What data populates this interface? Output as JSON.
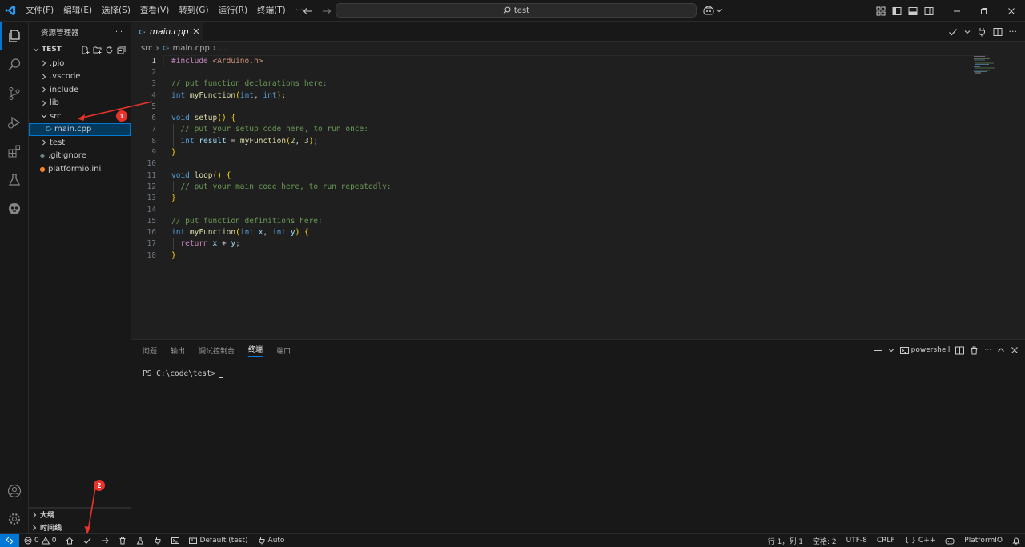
{
  "titlebar": {
    "menu": [
      "文件(F)",
      "编辑(E)",
      "选择(S)",
      "查看(V)",
      "转到(G)",
      "运行(R)",
      "终端(T)",
      "···"
    ],
    "search_text": "test"
  },
  "sidebar": {
    "header": "资源管理器",
    "more": "···",
    "folder": "TEST",
    "tree": [
      {
        "label": ".pio",
        "type": "folder"
      },
      {
        "label": ".vscode",
        "type": "folder"
      },
      {
        "label": "include",
        "type": "folder"
      },
      {
        "label": "lib",
        "type": "folder"
      },
      {
        "label": "src",
        "type": "folder-open"
      },
      {
        "label": "main.cpp",
        "type": "cpp",
        "selected": true
      },
      {
        "label": "test",
        "type": "folder"
      },
      {
        "label": ".gitignore",
        "type": "git"
      },
      {
        "label": "platformio.ini",
        "type": "ini"
      }
    ],
    "sections": [
      "大纲",
      "时间线"
    ]
  },
  "editor": {
    "tab_label": "main.cpp",
    "breadcrumb": [
      "src",
      "main.cpp",
      "..."
    ],
    "current_line": 1,
    "lines": [
      "#include <Arduino.h>",
      "",
      "// put function declarations here:",
      "int myFunction(int, int);",
      "",
      "void setup() {",
      "  // put your setup code here, to run once:",
      "  int result = myFunction(2, 3);",
      "}",
      "",
      "void loop() {",
      "  // put your main code here, to run repeatedly:",
      "}",
      "",
      "// put function definitions here:",
      "int myFunction(int x, int y) {",
      "  return x + y;",
      "}"
    ]
  },
  "panel": {
    "tabs": [
      "问题",
      "输出",
      "调试控制台",
      "终端",
      "端口"
    ],
    "active_tab": "终端",
    "shell": "powershell",
    "prompt": "PS C:\\code\\test>"
  },
  "statusbar": {
    "errors": "0",
    "warnings": "0",
    "env": "Default (test)",
    "auto": "Auto",
    "position": "行 1，列 1",
    "spaces": "空格: 2",
    "encoding": "UTF-8",
    "eol": "CRLF",
    "language": "C++",
    "platformio": "PlatformIO"
  },
  "annotations": [
    "1",
    "2"
  ],
  "colors": {
    "accent": "#0078d4",
    "keyword": "#569cd6",
    "comment": "#6a9955",
    "function": "#dcdcaa",
    "string": "#ce9178",
    "include": "#c586c0",
    "annotation": "#e8332a"
  }
}
